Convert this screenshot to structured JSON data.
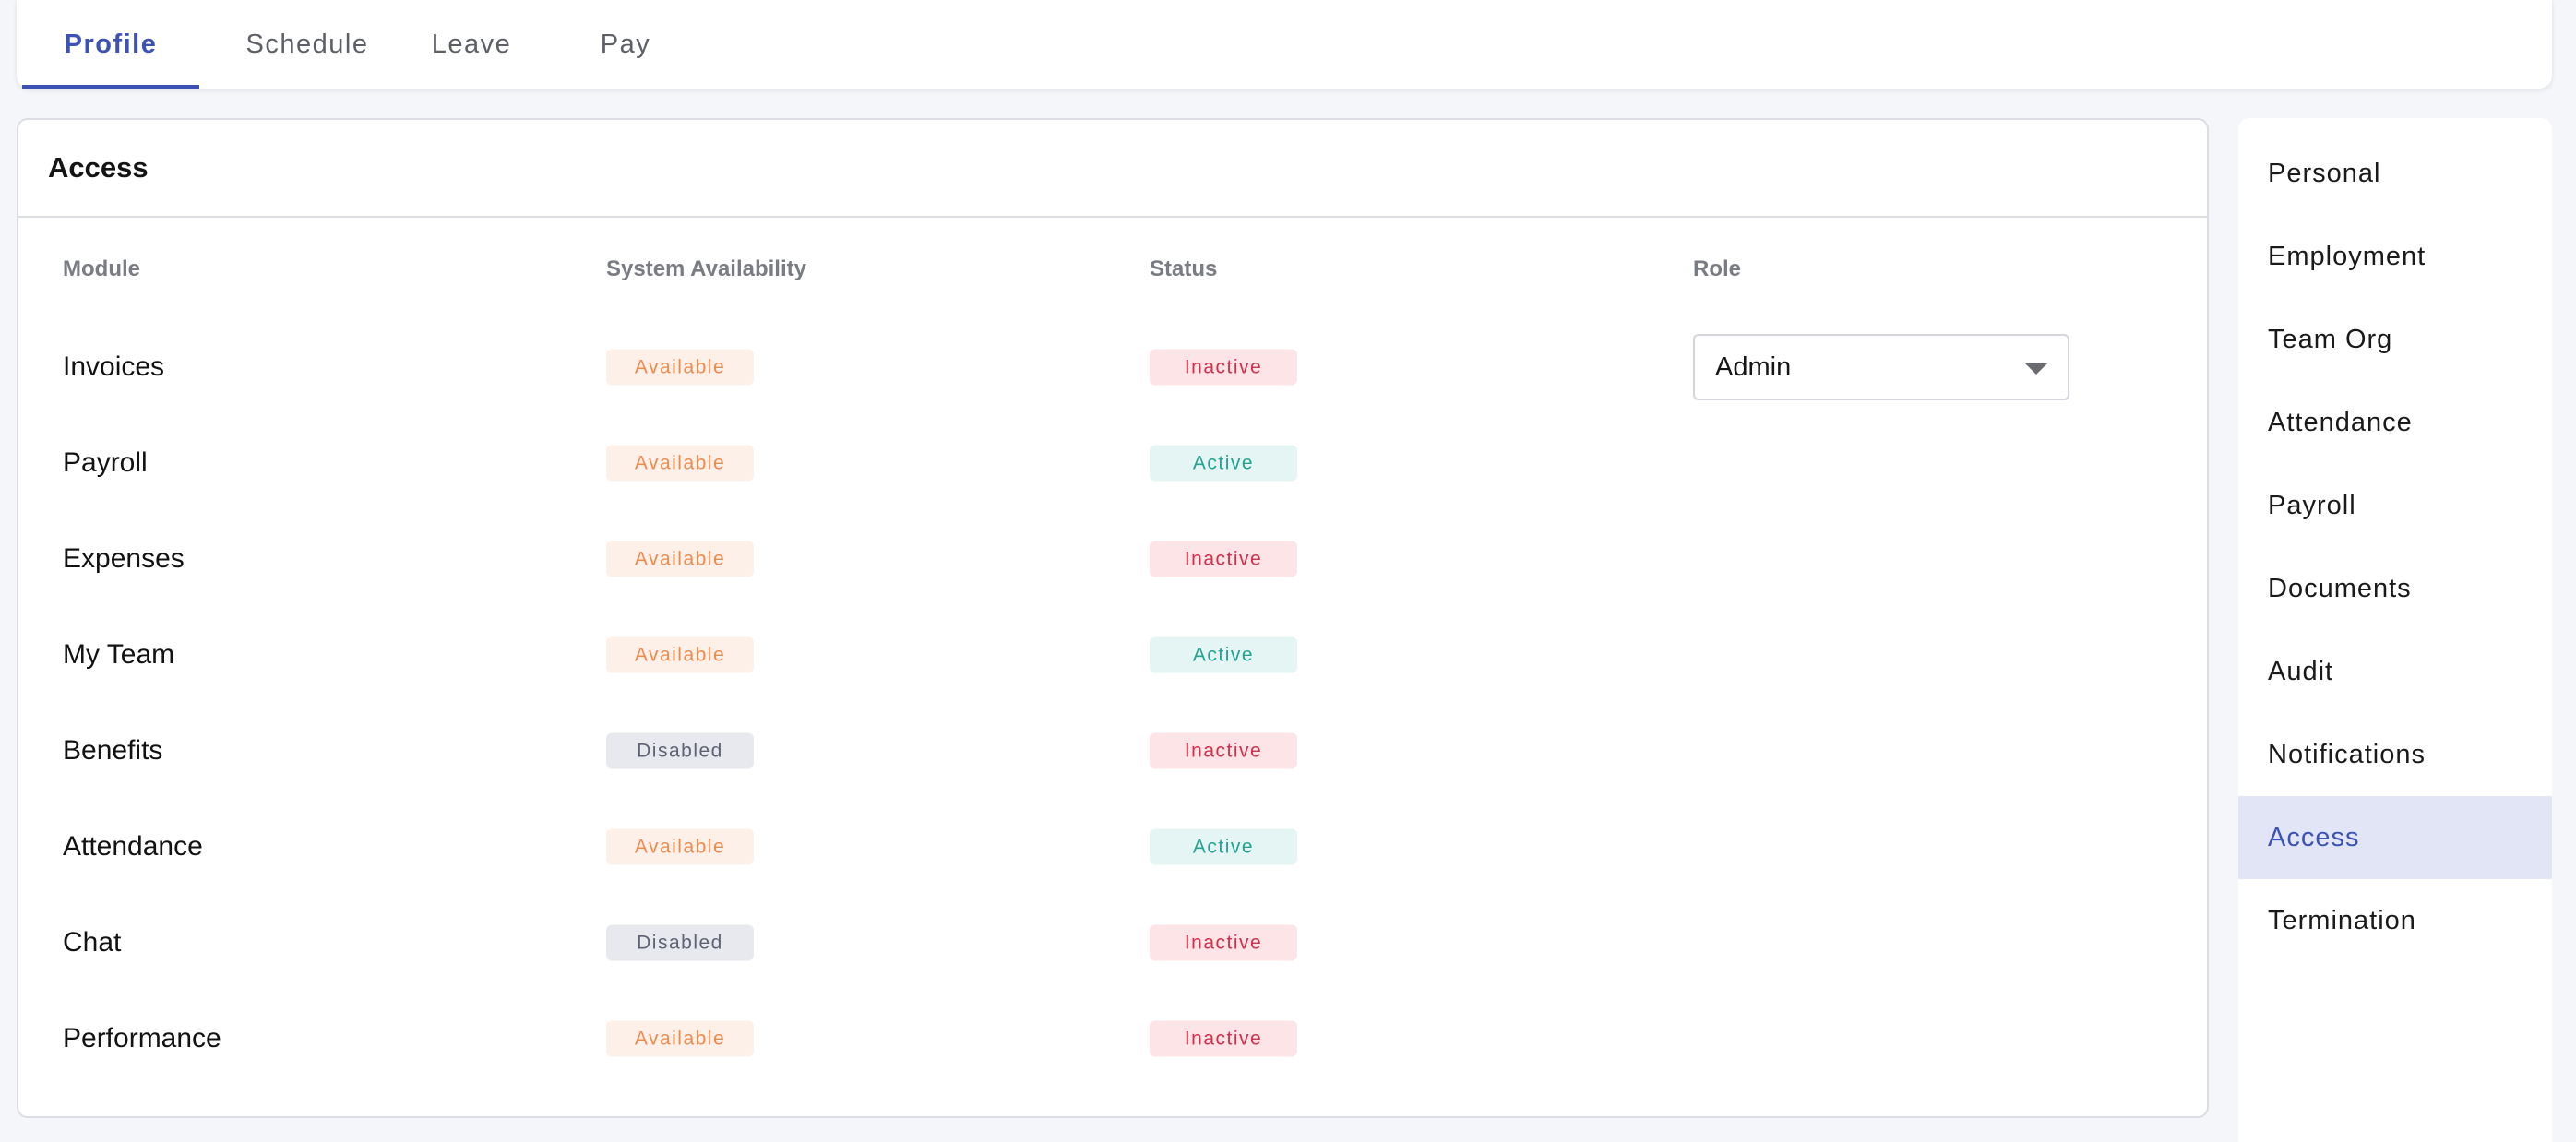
{
  "tabs": [
    {
      "label": "Profile",
      "active": true
    },
    {
      "label": "Schedule",
      "active": false
    },
    {
      "label": "Leave",
      "active": false
    },
    {
      "label": "Pay",
      "active": false
    }
  ],
  "panel": {
    "title": "Access",
    "columns": [
      "Module",
      "System Availability",
      "Status",
      "Role"
    ],
    "rows": [
      {
        "module": "Invoices",
        "availability": "Available",
        "status": "Inactive",
        "role": "Admin"
      },
      {
        "module": "Payroll",
        "availability": "Available",
        "status": "Active"
      },
      {
        "module": "Expenses",
        "availability": "Available",
        "status": "Inactive"
      },
      {
        "module": "My Team",
        "availability": "Available",
        "status": "Active"
      },
      {
        "module": "Benefits",
        "availability": "Disabled",
        "status": "Inactive"
      },
      {
        "module": "Attendance",
        "availability": "Available",
        "status": "Active"
      },
      {
        "module": "Chat",
        "availability": "Disabled",
        "status": "Inactive"
      },
      {
        "module": "Performance",
        "availability": "Available",
        "status": "Inactive"
      }
    ],
    "role_dropdown_icon": "chevron-down-icon"
  },
  "sidenav": {
    "items": [
      {
        "label": "Personal",
        "active": false
      },
      {
        "label": "Employment",
        "active": false
      },
      {
        "label": "Team Org",
        "active": false
      },
      {
        "label": "Attendance",
        "active": false
      },
      {
        "label": "Payroll",
        "active": false
      },
      {
        "label": "Documents",
        "active": false
      },
      {
        "label": "Audit",
        "active": false
      },
      {
        "label": "Notifications",
        "active": false
      },
      {
        "label": "Access",
        "active": true
      },
      {
        "label": "Termination",
        "active": false
      }
    ]
  },
  "colors": {
    "accent": "#3d52b5",
    "available": "#ee8a4e",
    "disabled": "#5e6274",
    "inactive": "#d32f4c",
    "active": "#23a293",
    "nav_active_bg": "#e2e5f5"
  }
}
